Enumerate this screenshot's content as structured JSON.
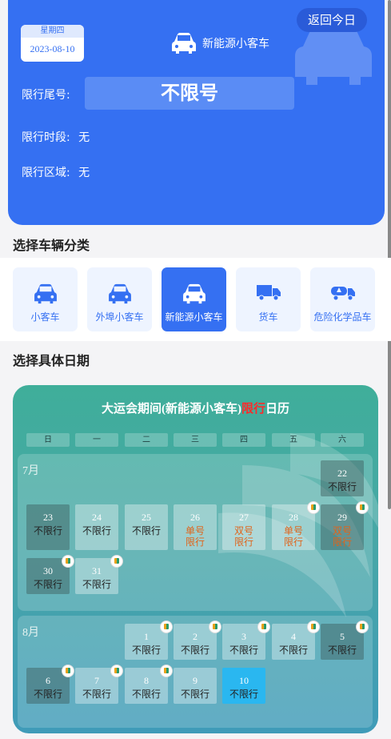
{
  "header": {
    "weekday": "星期四",
    "date": "2023-08-10",
    "today_button": "返回今日",
    "vehicle_type": "新能源小客车",
    "plate_label": "限行尾号:",
    "plate_value": "不限号",
    "time_label": "限行时段:",
    "time_value": "无",
    "area_label": "限行区域:",
    "area_value": "无"
  },
  "section_vehicle": "选择车辆分类",
  "categories": [
    {
      "label": "小客车",
      "icon": "car-icon"
    },
    {
      "label": "外埠小客车",
      "icon": "car-icon"
    },
    {
      "label": "新能源小客车",
      "icon": "car-icon",
      "active": true
    },
    {
      "label": "货车",
      "icon": "truck-icon"
    },
    {
      "label": "危险化学品车",
      "icon": "tanker-icon"
    }
  ],
  "section_date": "选择具体日期",
  "calendar": {
    "title_pre": "大运会期间(新能源小客车)",
    "title_red": "限行",
    "title_post": "日历",
    "weekdays": [
      "日",
      "一",
      "二",
      "三",
      "四",
      "五",
      "六"
    ],
    "july": {
      "label": "7月",
      "days": [
        {
          "n": "22",
          "s": "不限行"
        },
        {
          "n": "23",
          "s": "不限行"
        },
        {
          "n": "24",
          "s": "不限行"
        },
        {
          "n": "25",
          "s": "不限行"
        },
        {
          "n": "26",
          "s": "单号\n限行"
        },
        {
          "n": "27",
          "s": "双号\n限行"
        },
        {
          "n": "28",
          "s": "单号\n限行"
        },
        {
          "n": "29",
          "s": "双号\n限行"
        },
        {
          "n": "30",
          "s": "不限行"
        },
        {
          "n": "31",
          "s": "不限行"
        }
      ]
    },
    "august": {
      "label": "8月",
      "days": [
        {
          "n": "1",
          "s": "不限行"
        },
        {
          "n": "2",
          "s": "不限行"
        },
        {
          "n": "3",
          "s": "不限行"
        },
        {
          "n": "4",
          "s": "不限行"
        },
        {
          "n": "5",
          "s": "不限行"
        },
        {
          "n": "6",
          "s": "不限行"
        },
        {
          "n": "7",
          "s": "不限行"
        },
        {
          "n": "8",
          "s": "不限行"
        },
        {
          "n": "9",
          "s": "不限行"
        },
        {
          "n": "10",
          "s": "不限行"
        }
      ]
    }
  },
  "colors": {
    "primary": "#3570f2",
    "restricted": "#e0641a",
    "today": "#2ab7f0"
  }
}
